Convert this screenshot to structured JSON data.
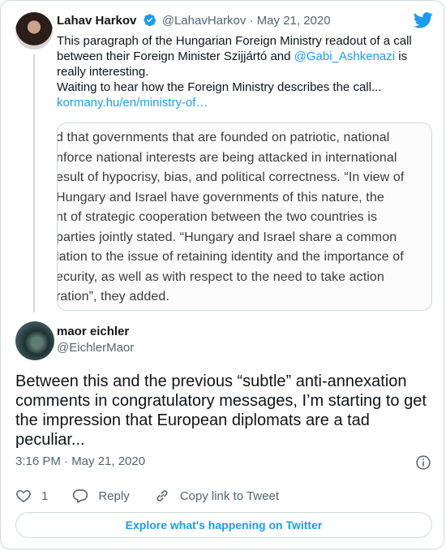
{
  "quoted": {
    "name": "Lahav Harkov",
    "handle": "@LahavHarkov",
    "separator": "·",
    "date": "May 21, 2020",
    "text_before": "This paragraph of the Hungarian Foreign Ministry readout of a call between their Foreign Minister Szijjártó and ",
    "mention": "@Gabi_Ashkenazi",
    "text_after": " is really interesting.",
    "line2": "Waiting to hear how the Foreign Ministry describes the call...",
    "link": "kormany.hu/en/ministry-of…",
    "media_lines": [
      "d that governments that are founded on patriotic, national",
      "nforce national interests are being attacked in international",
      "esult of hypocrisy, bias, and political correctness. “In view of",
      "Hungary and Israel have governments of this nature, the",
      "nt of strategic cooperation between the two countries is",
      "parties jointly stated. “Hungary and Israel share a common",
      "lation to the issue of retaining identity and the importance of",
      "ecurity, as well as with respect to the need to take action",
      "ration”, they added."
    ]
  },
  "main": {
    "name": "maor eichler",
    "handle": "@EichlerMaor",
    "text": "Between this and the previous “subtle” anti-annexation comments in congratulatory messages, I’m starting to get the impression that European diplomats are a tad peculiar...",
    "time": "3:16 PM · May 21, 2020",
    "likes": "1",
    "reply_label": "Reply",
    "copy_link_label": "Copy link to Tweet",
    "explore_label": "Explore what's happening on Twitter"
  },
  "icons": {
    "brand": "twitter-bird-icon",
    "verified": "verified-badge-icon",
    "info": "info-icon",
    "like": "heart-icon",
    "reply": "reply-icon",
    "link": "link-icon"
  },
  "colors": {
    "accent": "#1d9bf0",
    "muted": "#536471",
    "border": "#cfd9de",
    "text": "#0f1419"
  }
}
